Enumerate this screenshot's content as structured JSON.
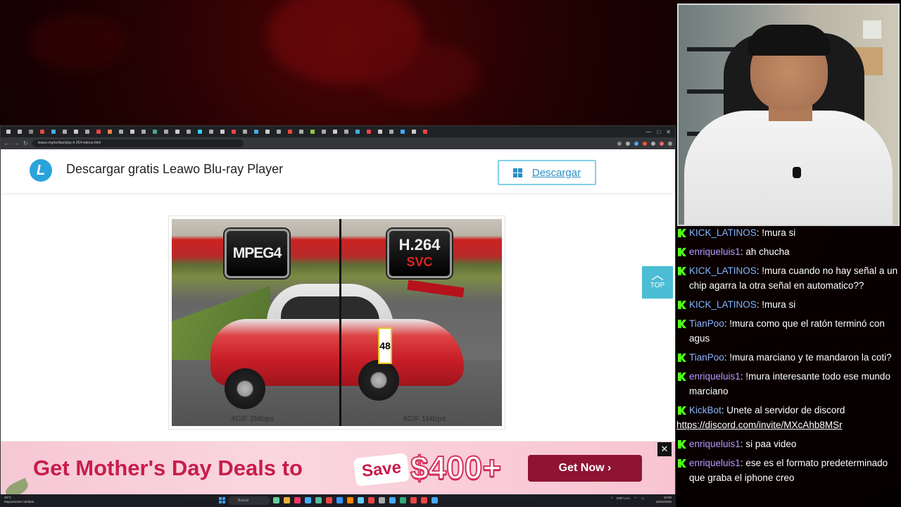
{
  "browser": {
    "url": "leawo.org/es/tips/play-h-264-videos.html",
    "window_controls": [
      "—",
      "□",
      "✕"
    ],
    "tab_colors": [
      "#ccc",
      "#bbb",
      "#888",
      "#e44",
      "#4ad",
      "#aaa",
      "#ccc",
      "#aaa",
      "#e44",
      "#e84",
      "#aaa",
      "#ccc",
      "#aaa",
      "#4a8",
      "#aaa",
      "#ccc",
      "#aaa",
      "#3cf",
      "#aaa",
      "#ccc",
      "#e44",
      "#aaa",
      "#4ad",
      "#ccc",
      "#aaa",
      "#e44",
      "#aaa",
      "#8c4",
      "#aaa",
      "#ccc",
      "#aaa",
      "#4ad",
      "#e44",
      "#ccc",
      "#aaa",
      "#4af",
      "#ccc",
      "#e44"
    ]
  },
  "site": {
    "logo_letter": "L",
    "title": "Descargar gratis Leawo Blu-ray Player",
    "download_label": "Descargar",
    "accent": "#2aa3dc"
  },
  "figure": {
    "left_codec": "MPEG4",
    "right_codec_main": "H.264",
    "right_codec_sub": "SVC",
    "left_caption": "4CIF 2Mbps",
    "right_caption": "4CIF 1Mbps",
    "car_number": "48"
  },
  "top_button": {
    "icon": "chevron-up-icon",
    "label": "TOP"
  },
  "ad": {
    "headline": "Get Mother's Day Deals to",
    "save": "Save",
    "amount": "$400+",
    "cta": "Get Now ›",
    "close": "✕"
  },
  "taskbar": {
    "weather": "26°C",
    "weather_desc": "Mayormente nublado",
    "search_placeholder": "Buscar",
    "tray_lang": "ESP LAA",
    "time": "16:50",
    "date": "16/04/2025",
    "app_colors": [
      "#6c9",
      "#e8b339",
      "#f36",
      "#4af",
      "#5b9",
      "#e44",
      "#39f",
      "#f80",
      "#6cf",
      "#e44",
      "#aaa",
      "#4af",
      "#3a7",
      "#e44",
      "#e44",
      "#4af"
    ]
  },
  "chat": {
    "messages": [
      {
        "user": "KICK_LATINOS",
        "user_color": "#7fb7ff",
        "text": "!mura si"
      },
      {
        "user": "enriqueluis1",
        "user_color": "#b39bff",
        "text": "ah chucha"
      },
      {
        "user": "KICK_LATINOS",
        "user_color": "#7fb7ff",
        "text": "!mura cuando no hay señal a un chip agarra la otra señal en automatico??"
      },
      {
        "user": "KICK_LATINOS",
        "user_color": "#7fb7ff",
        "text": "!mura si"
      },
      {
        "user": "TianPoo",
        "user_color": "#8fb4ff",
        "text": "!mura como que el ratón terminó con agus"
      },
      {
        "user": "TianPoo",
        "user_color": "#8fb4ff",
        "text": "!mura marciano y te mandaron la coti?"
      },
      {
        "user": "enriqueluis1",
        "user_color": "#b39bff",
        "text": "!mura interesante todo ese mundo marciano"
      },
      {
        "user": "KickBot",
        "user_color": "#8fb4ff",
        "text": "Unete al servidor de discord",
        "link": "https://discord.com/invite/MXcAhb8MSr"
      },
      {
        "user": "enriqueluis1",
        "user_color": "#b39bff",
        "text": "si paa video"
      },
      {
        "user": "enriqueluis1",
        "user_color": "#b39bff",
        "text": "ese es el formato predeterminado que graba el iphone creo"
      }
    ]
  }
}
